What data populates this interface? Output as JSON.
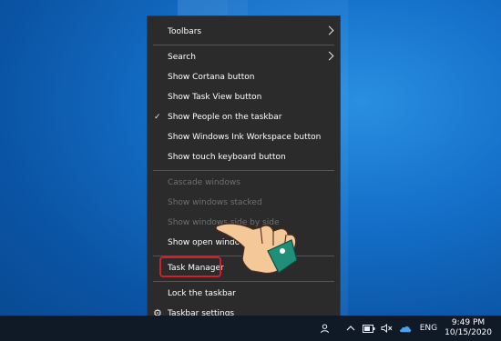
{
  "context_menu": {
    "items": [
      {
        "label": "Toolbars",
        "submenu": true
      },
      {
        "label": "Search",
        "submenu": true
      },
      {
        "label": "Show Cortana button"
      },
      {
        "label": "Show Task View button"
      },
      {
        "label": "Show People on the taskbar",
        "checked": true
      },
      {
        "label": "Show Windows Ink Workspace button"
      },
      {
        "label": "Show touch keyboard button"
      },
      {
        "label": "Cascade windows",
        "disabled": true
      },
      {
        "label": "Show windows stacked",
        "disabled": true
      },
      {
        "label": "Show windows side by side",
        "disabled": true
      },
      {
        "label": "Show open windows"
      },
      {
        "label": "Task Manager",
        "highlighted": true
      },
      {
        "label": "Lock the taskbar"
      },
      {
        "label": "Taskbar settings",
        "icon": "gear-icon"
      }
    ]
  },
  "taskbar": {
    "language": "ENG",
    "time": "9:49 PM",
    "date": "10/15/2020",
    "tray_icons": [
      "people-icon",
      "chevron-up-icon",
      "battery-icon",
      "volume-mute-icon",
      "onedrive-cloud-icon"
    ]
  },
  "colors": {
    "menu_bg": "#2b2b2b",
    "highlight_border": "#d1202a",
    "desktop_blue": "#1470c8"
  }
}
